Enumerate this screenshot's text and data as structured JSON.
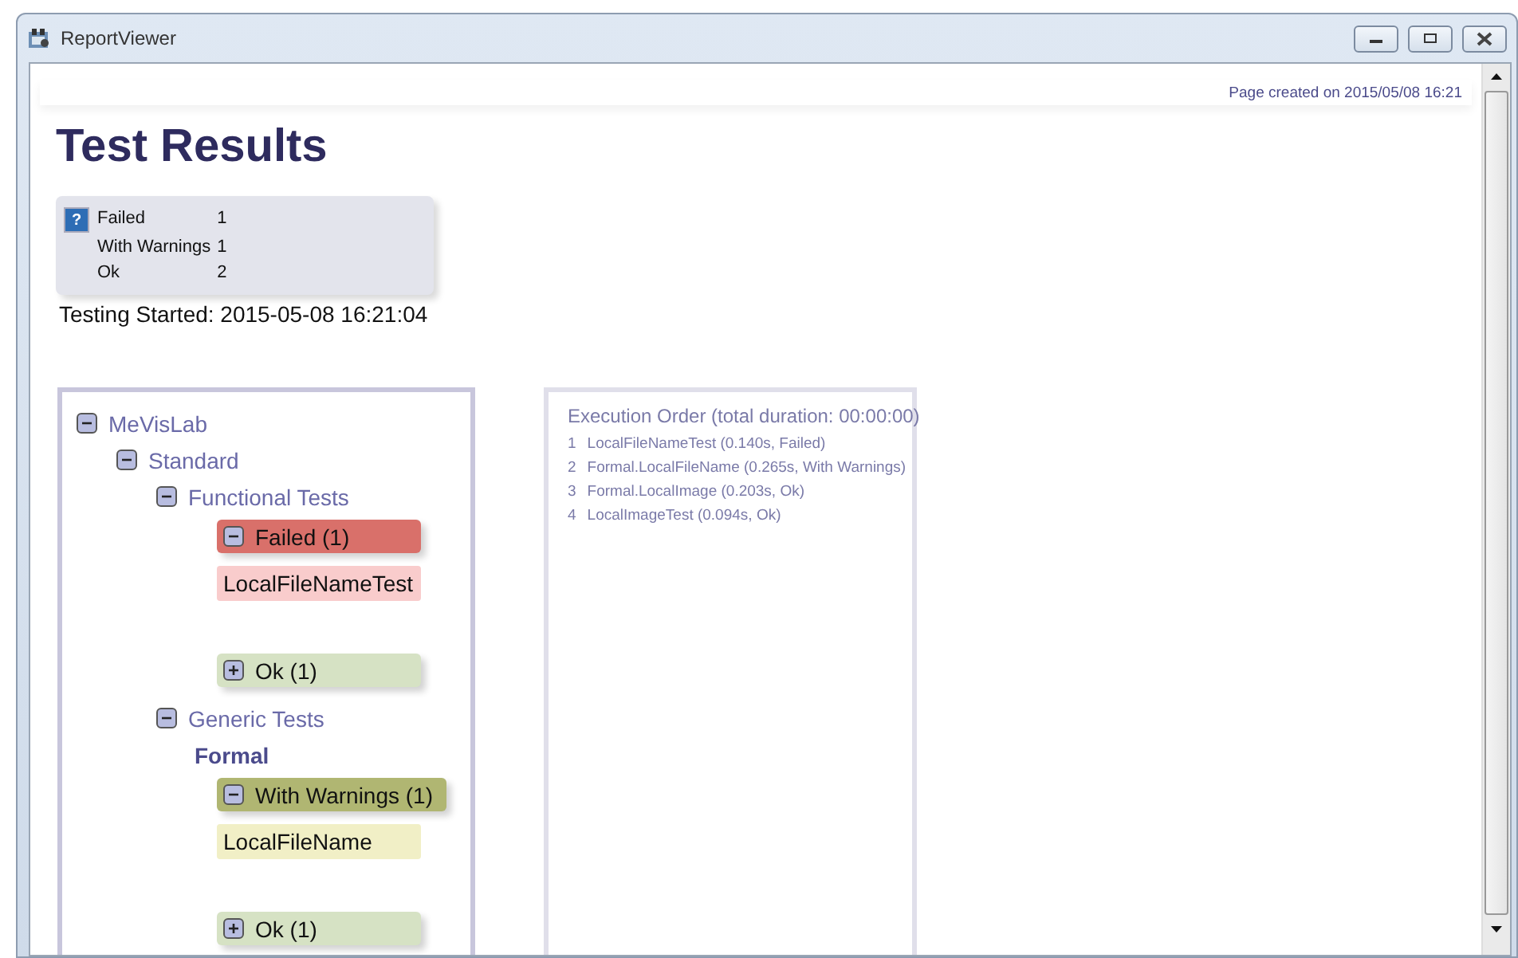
{
  "window": {
    "title": "ReportViewer"
  },
  "page_created": "Page created on 2015/05/08 16:21",
  "title": "Test Results",
  "summary": {
    "icon": "?",
    "rows": [
      {
        "label": "Failed",
        "count": "1"
      },
      {
        "label": "With Warnings",
        "count": "1"
      },
      {
        "label": "Ok",
        "count": "2"
      }
    ]
  },
  "testing_started": "Testing Started: 2015-05-08 16:21:04",
  "tree": [
    {
      "kind": "node",
      "label": "MeVisLab",
      "expanded": true,
      "children": [
        {
          "kind": "node",
          "label": "Standard",
          "expanded": true,
          "children": [
            {
              "kind": "node",
              "label": "Functional Tests",
              "expanded": true,
              "children": [
                {
                  "kind": "group",
                  "color": "#d9706a",
                  "label": "Failed (1)",
                  "expanded": true,
                  "children": [
                    {
                      "kind": "test",
                      "color": "#f9cccc",
                      "label": "LocalFileNameTest"
                    }
                  ]
                },
                {
                  "kind": "group",
                  "color": "#d6e2c4",
                  "label": "Ok (1)",
                  "expanded": false
                }
              ]
            },
            {
              "kind": "node",
              "label": "Generic Tests",
              "expanded": true,
              "children": [
                {
                  "kind": "heading",
                  "label": "Formal",
                  "children": [
                    {
                      "kind": "group",
                      "color": "#b0b672",
                      "label": "With Warnings (1)",
                      "expanded": true,
                      "children": [
                        {
                          "kind": "test",
                          "color": "#f1efc6",
                          "label": "LocalFileName"
                        }
                      ]
                    },
                    {
                      "kind": "group",
                      "color": "#d6e2c4",
                      "label": "Ok (1)",
                      "expanded": false
                    }
                  ]
                }
              ]
            }
          ]
        }
      ]
    }
  ],
  "execution_order": {
    "title": "Execution Order (total duration: 00:00:00)",
    "items": [
      {
        "number": "1",
        "text": "LocalFileNameTest (0.140s, Failed)"
      },
      {
        "number": "2",
        "text": "Formal.LocalFileName (0.265s, With Warnings)"
      },
      {
        "number": "3",
        "text": "Formal.LocalImage (0.203s, Ok)"
      },
      {
        "number": "4",
        "text": "LocalImageTest (0.094s, Ok)"
      }
    ]
  }
}
